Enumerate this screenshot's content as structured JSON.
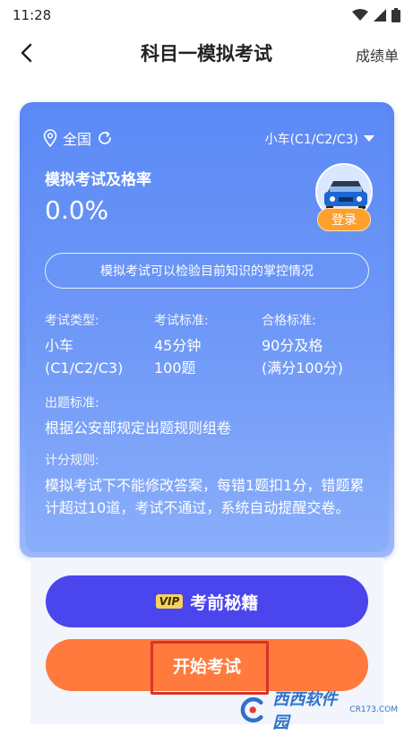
{
  "status_bar": {
    "time": "11:28",
    "icons": [
      "wifi-icon",
      "signal-icon",
      "battery-icon"
    ]
  },
  "nav": {
    "title": "科目一模拟考试",
    "right_label": "成绩单",
    "back_icon": "chevron-left-icon"
  },
  "card": {
    "location": "全国",
    "car_type": "小车(C1/C2/C3)",
    "pass_rate_label": "模拟考试及格率",
    "pass_rate_value": "0.0%",
    "login_label": "登录",
    "tip": "模拟考试可以检验目前知识的掌控情况",
    "exam_type": {
      "label": "考试类型:",
      "line1": "小车",
      "line2": "(C1/C2/C3)"
    },
    "exam_standard": {
      "label": "考试标准:",
      "line1": "45分钟",
      "line2": "100题"
    },
    "pass_standard": {
      "label": "合格标准:",
      "line1": "90分及格",
      "line2": "(满分100分)"
    },
    "question_standard": {
      "label": "出题标准:",
      "text": "根据公安部规定出题规则组卷"
    },
    "scoring_rule": {
      "label": "计分规则:",
      "text": "模拟考试下不能修改答案，每错1题扣1分，错题累计超过10道，考试不通过，系统自动提醒交卷。"
    }
  },
  "buttons": {
    "vip_tag": "VIP",
    "vip_label": "考前秘籍",
    "start_label": "开始考试"
  },
  "watermark": {
    "main": "西西软件园",
    "sub": "CR173.COM"
  },
  "colors": {
    "card_blue": "#6e98f7",
    "vip_button": "#4b45ee",
    "start_button": "#ff7a3c",
    "login_badge": "#ff9f2e",
    "highlight": "#d9322b"
  }
}
